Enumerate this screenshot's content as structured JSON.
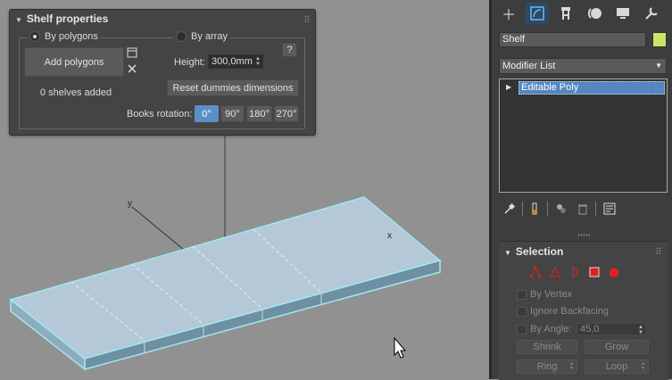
{
  "shelf_panel": {
    "title": "Shelf properties",
    "mode_polygons": "By polygons",
    "mode_array": "By array",
    "add_polygons": "Add polygons",
    "shelves_count": "0 shelves added",
    "help": "?",
    "height_label": "Height:",
    "height_value": "300,0mm",
    "reset_dummies": "Reset dummies dimensions",
    "books_rotation_label": "Books rotation:",
    "rotation_options": [
      "0°",
      "90°",
      "180°",
      "270°"
    ],
    "rotation_selected": "0°"
  },
  "viewport": {
    "axis_x": "x",
    "axis_y": "y"
  },
  "command_panel": {
    "tabs": [
      "create",
      "modify",
      "hierarchy",
      "motion",
      "display",
      "utilities"
    ],
    "object_name": "Shelf",
    "object_color": "#cbe46a",
    "modifier_list": "Modifier List",
    "stack_item": "Editable Poly",
    "selection": {
      "title": "Selection",
      "by_vertex": "By Vertex",
      "ignore_backfacing": "Ignore Backfacing",
      "by_angle_label": "By Angle:",
      "by_angle_value": "45,0",
      "shrink": "Shrink",
      "grow": "Grow",
      "ring": "Ring",
      "loop": "Loop"
    }
  },
  "colors": {
    "accent": "#5b8fc8",
    "selection_outline": "#9fe8f0",
    "subobject_red": "#e02020"
  }
}
